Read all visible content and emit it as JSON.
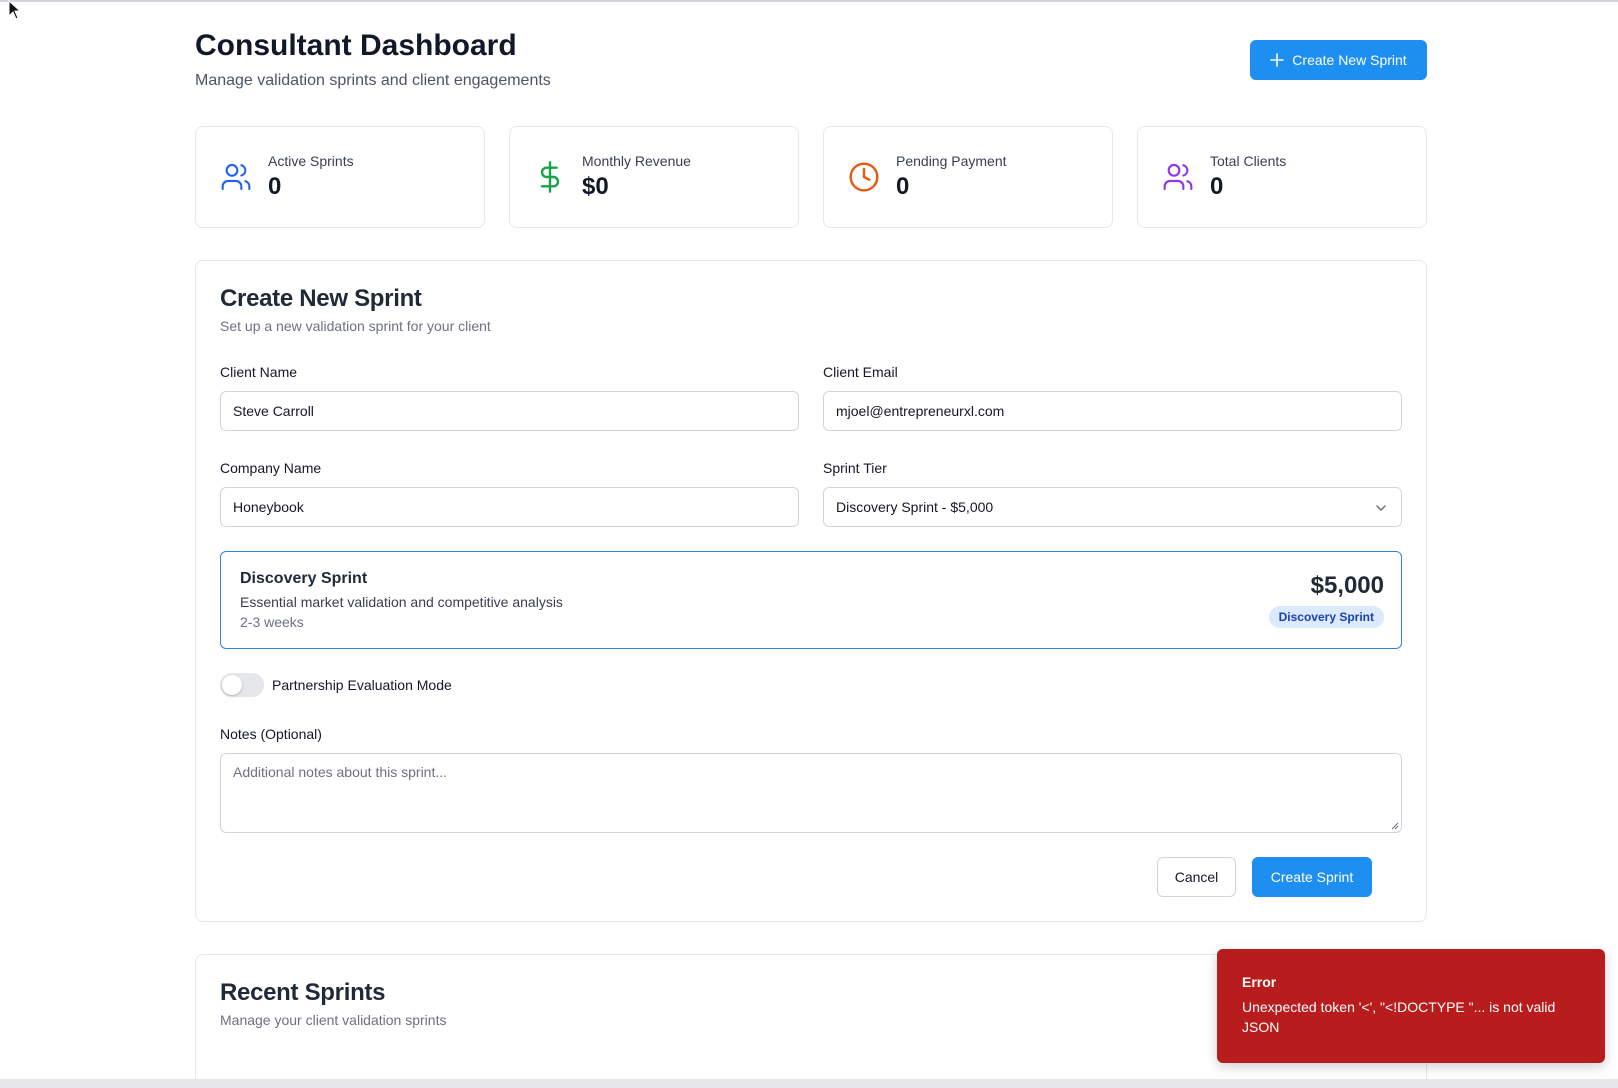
{
  "header": {
    "title": "Consultant Dashboard",
    "subtitle": "Manage validation sprints and client engagements",
    "create_button": "Create New Sprint"
  },
  "stats": [
    {
      "label": "Active Sprints",
      "value": "0",
      "icon": "users-icon",
      "color": "#2563eb"
    },
    {
      "label": "Monthly Revenue",
      "value": "$0",
      "icon": "dollar-icon",
      "color": "#16a34a"
    },
    {
      "label": "Pending Payment",
      "value": "0",
      "icon": "clock-icon",
      "color": "#ea580c"
    },
    {
      "label": "Total Clients",
      "value": "0",
      "icon": "users-icon",
      "color": "#9333ea"
    }
  ],
  "form": {
    "title": "Create New Sprint",
    "description": "Set up a new validation sprint for your client",
    "client_name": {
      "label": "Client Name",
      "value": "Steve Carroll"
    },
    "client_email": {
      "label": "Client Email",
      "value": "mjoel@entrepreneurxl.com"
    },
    "company_name": {
      "label": "Company Name",
      "value": "Honeybook"
    },
    "sprint_tier": {
      "label": "Sprint Tier",
      "value": "Discovery Sprint - $5,000"
    },
    "tier_details": {
      "name": "Discovery Sprint",
      "description": "Essential market validation and competitive analysis",
      "duration": "2-3 weeks",
      "price": "$5,000",
      "badge": "Discovery Sprint"
    },
    "partnership_toggle": {
      "label": "Partnership Evaluation Mode",
      "on": false
    },
    "notes": {
      "label": "Notes (Optional)",
      "placeholder": "Additional notes about this sprint..."
    },
    "cancel_button": "Cancel",
    "submit_button": "Create Sprint"
  },
  "recent": {
    "title": "Recent Sprints",
    "description": "Manage your client validation sprints"
  },
  "toast": {
    "title": "Error",
    "message": "Unexpected token '<', \"<!DOCTYPE \"... is not valid JSON",
    "color": "#b91c1c"
  },
  "colors": {
    "accent": "#1d8ff0",
    "tier_border": "#2f80ed"
  }
}
